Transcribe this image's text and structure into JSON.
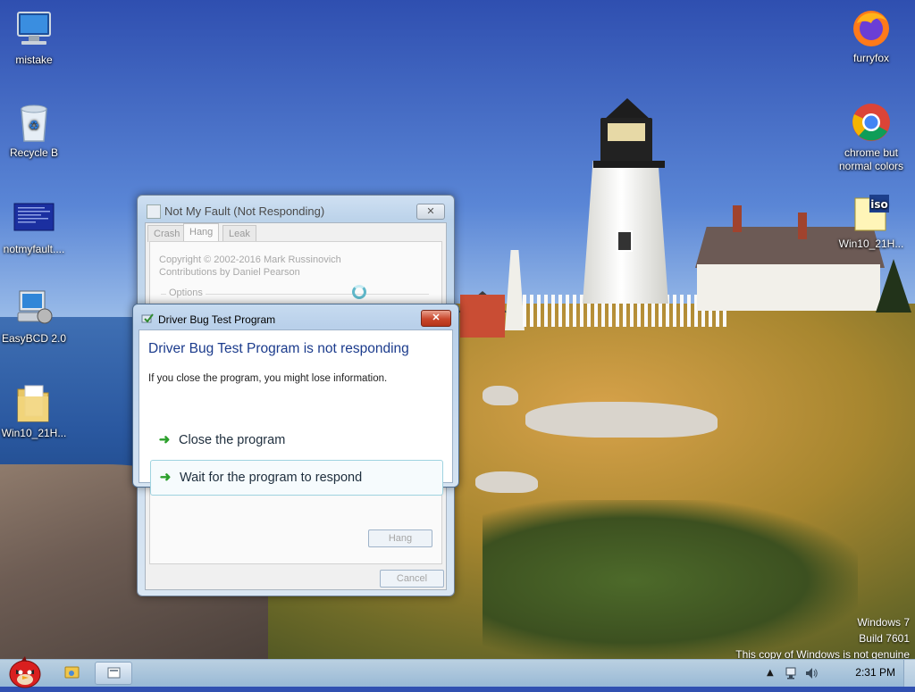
{
  "desktop": {
    "icons_left": [
      {
        "label": "mistake",
        "icon": "computer-icon"
      },
      {
        "label": "Recycle B",
        "icon": "recycle-bin-icon"
      },
      {
        "label": "notmyfault....",
        "icon": "bsod-image-icon"
      },
      {
        "label": "EasyBCD 2.0",
        "icon": "easybcd-icon"
      },
      {
        "label": "Win10_21H...",
        "icon": "folder-icon"
      }
    ],
    "icons_right": [
      {
        "label": "furryfox",
        "icon": "firefox-icon"
      },
      {
        "label": "chrome but normal colors",
        "icon": "chrome-icon"
      },
      {
        "label": "Win10_21H...",
        "icon": "iso-file-icon"
      }
    ]
  },
  "notmyfault_window": {
    "title": "Not My Fault (Not Responding)",
    "close_label": "✕",
    "tabs": [
      "Crash",
      "Hang",
      "Leak"
    ],
    "active_tab": "Hang",
    "copyright": "Copyright © 2002-2016 Mark Russinovich",
    "contributions": "Contributions by Daniel Pearson",
    "options_label": "Options",
    "hang_button": "Hang",
    "cancel_button": "Cancel"
  },
  "dialog": {
    "title": "Driver Bug Test Program",
    "close_label": "✕",
    "heading": "Driver Bug Test Program is not responding",
    "message": "If you close the program, you might lose information.",
    "options": [
      {
        "label": "Close the program"
      },
      {
        "label": "Wait for the program to respond"
      }
    ]
  },
  "watermark": {
    "line1": "Windows 7",
    "line2": "Build 7601",
    "line3": "This copy of Windows is not genuine"
  },
  "taskbar": {
    "clock": "2:31 PM",
    "tray_icons": [
      "show-hidden-icons-arrow-icon",
      "network-icon",
      "volume-icon"
    ],
    "pinned": [
      "angry-birds-start-icon",
      "explorer-icon",
      "notmyfault-taskbar-icon"
    ]
  }
}
